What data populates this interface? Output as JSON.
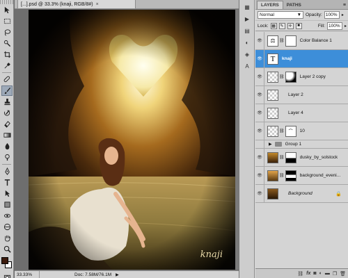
{
  "document": {
    "tab_title": "[...].psd @ 33.3% (knaji, RGB/8#)",
    "close_glyph": "×"
  },
  "status": {
    "zoom": "33.33%",
    "doc_size": "Doc: 7.58M/76.1M"
  },
  "canvas": {
    "signature_text": "knaji"
  },
  "layers_panel": {
    "tabs": [
      "LAYERS",
      "PATHS"
    ],
    "menu_glyph": "≡",
    "blend_mode": "Normal",
    "opacity_label": "Opacity:",
    "opacity_value": "100%",
    "lock_label": "Lock:",
    "fill_label": "Fill:",
    "fill_value": "100%",
    "layers": [
      {
        "name": "Color Balance 1"
      },
      {
        "name": "knaji"
      },
      {
        "name": "Layer 2 copy"
      },
      {
        "name": "Layer 2"
      },
      {
        "name": "Layer 4"
      },
      {
        "name": "10"
      },
      {
        "name": "Group 1"
      },
      {
        "name": "dusky_by_solstock"
      },
      {
        "name": "background_eveni..."
      },
      {
        "name": "Background"
      }
    ],
    "footer_icons": [
      "link-icon",
      "fx-icon",
      "mask-icon",
      "adjustment-icon",
      "folder-icon",
      "new-layer-icon",
      "trash-icon"
    ]
  },
  "colors": {
    "selected_layer": "#3d8ed9",
    "foreground_swatch": "#3b1a0c",
    "background_swatch": "#ffffff"
  }
}
